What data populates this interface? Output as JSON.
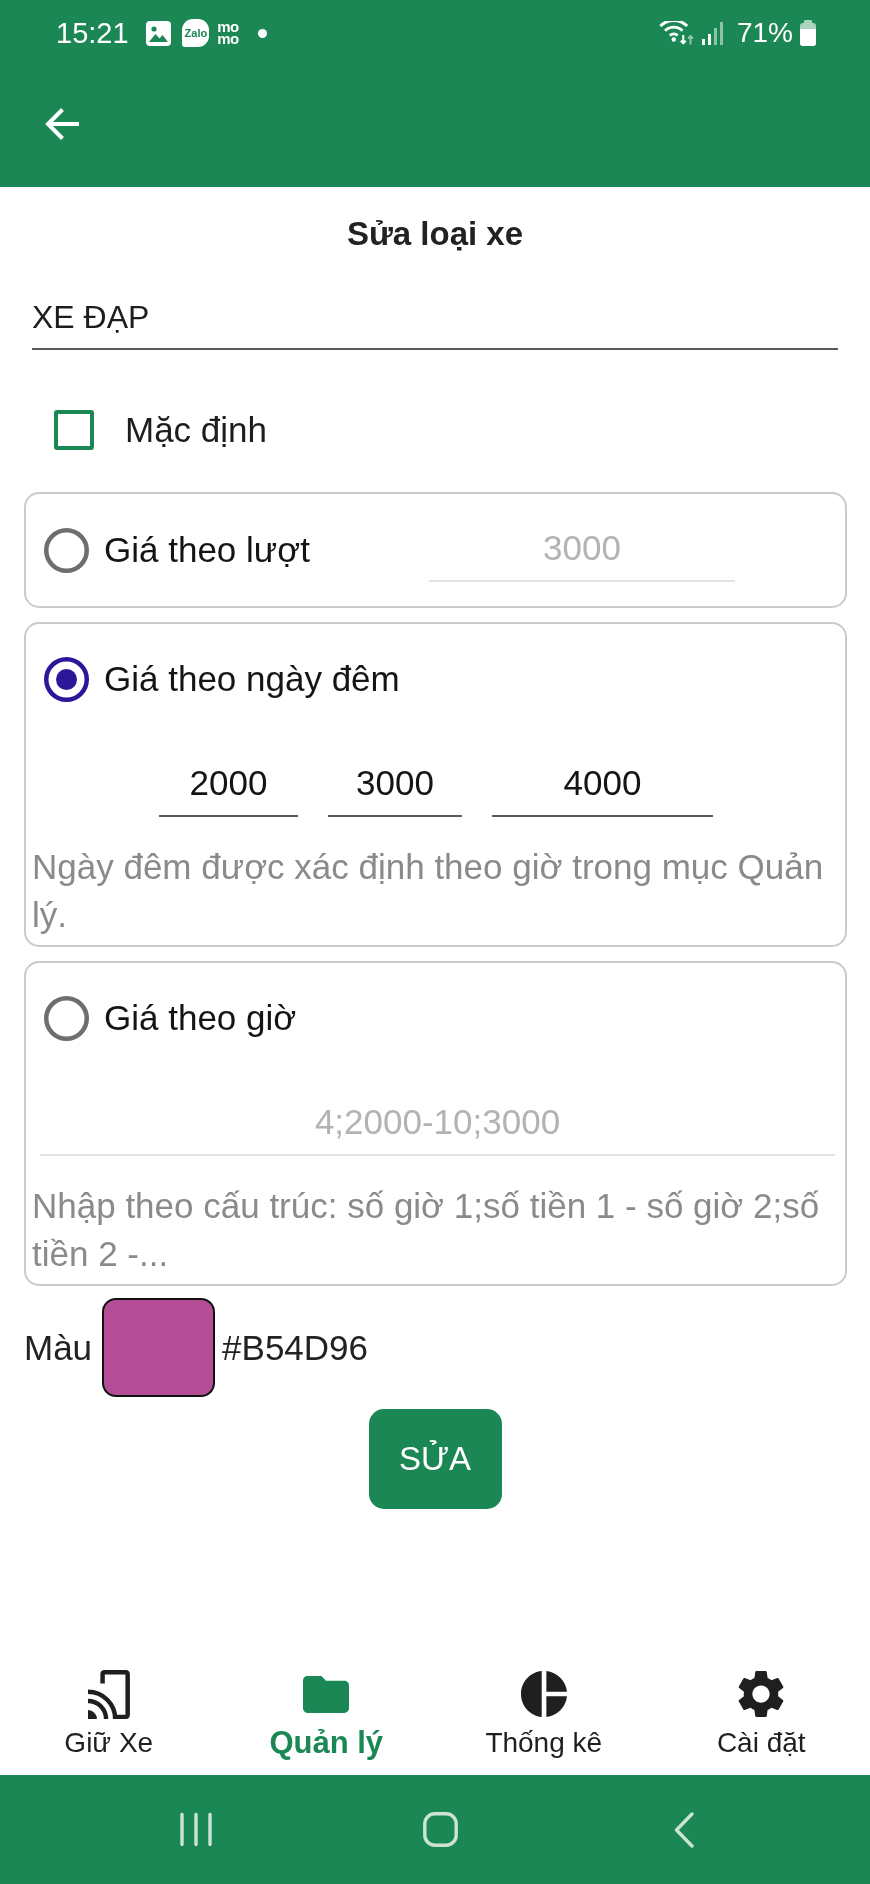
{
  "status_bar": {
    "time": "15:21",
    "notification_icons": [
      {
        "kind": "image"
      },
      {
        "kind": "bubble",
        "text": "Zalo"
      },
      {
        "kind": "stacked",
        "text": "mo mo"
      },
      {
        "kind": "dot"
      }
    ],
    "battery": "71%"
  },
  "title": "Sửa loại xe",
  "name_field": {
    "value": "XE ĐẠP"
  },
  "default_option": {
    "label": "Mặc định",
    "checked": false
  },
  "pricing_options": [
    {
      "kind": "inline",
      "label": "Giá theo lượt",
      "selected": false,
      "fields": [
        {
          "placeholder": "3000"
        }
      ]
    },
    {
      "kind": "stacked",
      "label": "Giá theo ngày đêm",
      "selected": true,
      "fields": [
        {
          "value": "2000"
        },
        {
          "value": "3000"
        },
        {
          "value": "4000"
        }
      ],
      "hint": "Ngày đêm được xác định theo giờ trong mục Quản lý."
    },
    {
      "kind": "stacked",
      "label": "Giá theo giờ",
      "selected": false,
      "fields": [
        {
          "placeholder": "4;2000-10;3000"
        }
      ],
      "hint": "Nhập theo cấu trúc: số giờ 1;số tiền 1 - số giờ 2;số tiền 2 -..."
    }
  ],
  "color_field": {
    "label": "Màu",
    "color": "#b54d96",
    "hex": "#B54D96"
  },
  "submit_button": "SỬA",
  "bottom_nav": [
    {
      "label": "Giữ Xe",
      "selected": false
    },
    {
      "label": "Quản lý",
      "selected": true
    },
    {
      "label": "Thống kê",
      "selected": false
    },
    {
      "label": "Cài đặt",
      "selected": false
    }
  ]
}
